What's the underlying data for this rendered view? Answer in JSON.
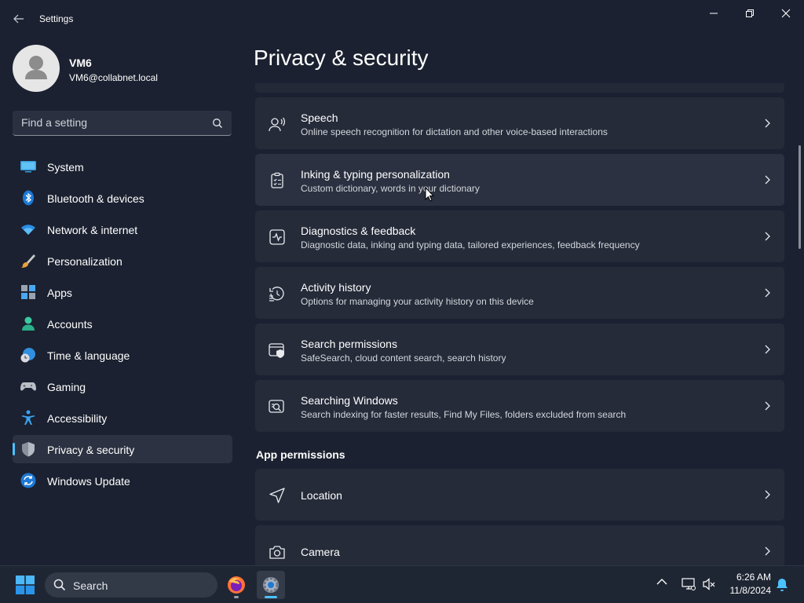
{
  "window": {
    "app_title": "Settings"
  },
  "profile": {
    "name": "VM6",
    "email": "VM6@collabnet.local"
  },
  "search": {
    "placeholder": "Find a setting"
  },
  "nav": {
    "items": [
      {
        "label": "System",
        "icon": "monitor-icon"
      },
      {
        "label": "Bluetooth & devices",
        "icon": "bluetooth-icon"
      },
      {
        "label": "Network & internet",
        "icon": "wifi-icon"
      },
      {
        "label": "Personalization",
        "icon": "brush-icon"
      },
      {
        "label": "Apps",
        "icon": "apps-icon"
      },
      {
        "label": "Accounts",
        "icon": "person-icon"
      },
      {
        "label": "Time & language",
        "icon": "globe-clock-icon"
      },
      {
        "label": "Gaming",
        "icon": "gamepad-icon"
      },
      {
        "label": "Accessibility",
        "icon": "accessibility-icon"
      },
      {
        "label": "Privacy & security",
        "icon": "shield-icon",
        "selected": true
      },
      {
        "label": "Windows Update",
        "icon": "update-icon"
      }
    ]
  },
  "page": {
    "title": "Privacy & security"
  },
  "cards": [
    {
      "title": "Speech",
      "desc": "Online speech recognition for dictation and other voice-based interactions",
      "icon": "speech-icon"
    },
    {
      "title": "Inking & typing personalization",
      "desc": "Custom dictionary, words in your dictionary",
      "icon": "clipboard-list-icon"
    },
    {
      "title": "Diagnostics & feedback",
      "desc": "Diagnostic data, inking and typing data, tailored experiences, feedback frequency",
      "icon": "diagnostics-icon"
    },
    {
      "title": "Activity history",
      "desc": "Options for managing your activity history on this device",
      "icon": "history-icon"
    },
    {
      "title": "Search permissions",
      "desc": "SafeSearch, cloud content search, search history",
      "icon": "search-shield-icon"
    },
    {
      "title": "Searching Windows",
      "desc": "Search indexing for faster results, Find My Files, folders excluded from search",
      "icon": "search-windows-icon"
    }
  ],
  "app_permissions": {
    "header": "App permissions",
    "items": [
      {
        "title": "Location",
        "icon": "location-arrow-icon"
      },
      {
        "title": "Camera",
        "icon": "camera-icon"
      }
    ]
  },
  "taskbar": {
    "search_label": "Search",
    "time": "6:26 AM",
    "date": "11/8/2024"
  },
  "colors": {
    "accent": "#4cc2ff",
    "window_bg": "#1b2130",
    "card_bg": "#252b39"
  }
}
